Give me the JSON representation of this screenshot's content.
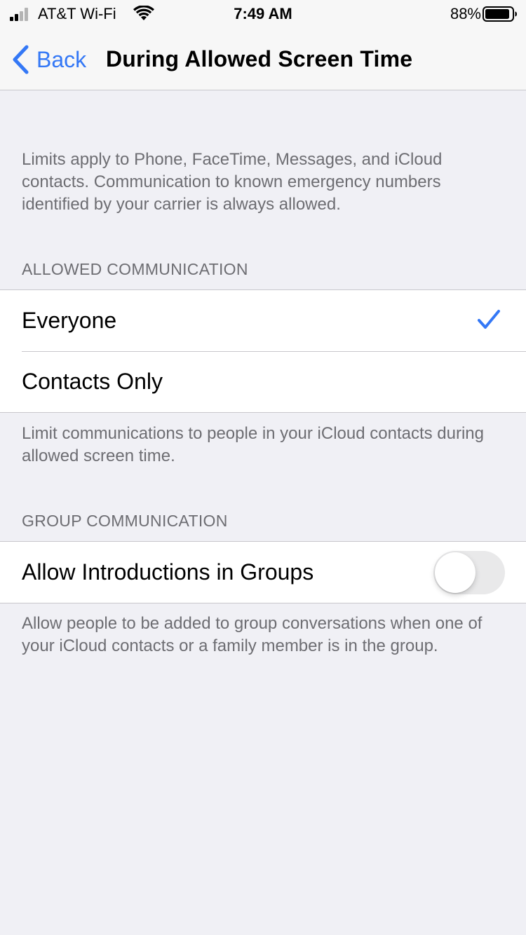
{
  "status_bar": {
    "carrier": "AT&T Wi-Fi",
    "time": "7:49 AM",
    "battery": "88%"
  },
  "nav": {
    "back_label": "Back",
    "title": "During Allowed Screen Time"
  },
  "intro_text": "Limits apply to Phone, FaceTime, Messages, and iCloud contacts. Communication to known emergency numbers identified by your carrier is always allowed.",
  "allowed_communication": {
    "header": "ALLOWED COMMUNICATION",
    "options": [
      {
        "label": "Everyone",
        "selected": true
      },
      {
        "label": "Contacts Only",
        "selected": false
      }
    ],
    "footer": "Limit communications to people in your iCloud contacts during allowed screen time."
  },
  "group_communication": {
    "header": "GROUP COMMUNICATION",
    "toggle_label": "Allow Introductions in Groups",
    "toggle_on": false,
    "footer": "Allow people to be added to group conversations when one of your iCloud contacts or a family member is in the group."
  },
  "colors": {
    "accent": "#3478f6",
    "background": "#f0f0f5",
    "secondary_text": "#6d6d72"
  }
}
